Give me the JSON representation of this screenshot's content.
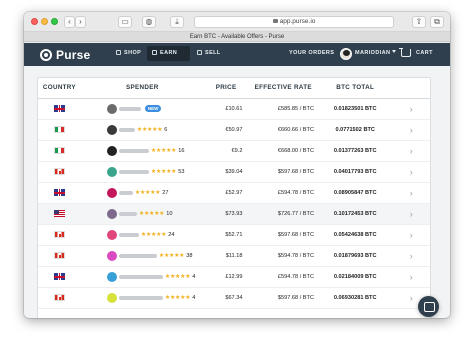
{
  "browser": {
    "url": "app.purse.io",
    "tab_title": "Earn BTC - Available Offers - Purse"
  },
  "nav": {
    "logo_text": "Purse",
    "shop": "SHOP",
    "earn": "EARN",
    "sell": "SELL",
    "your_orders": "YOUR ORDERS",
    "username": "MARIODIAN",
    "cart": "CART"
  },
  "table": {
    "headers": {
      "country": "COUNTRY",
      "spender": "SPENDER",
      "price": "PRICE",
      "effective_rate": "EFFECTIVE RATE",
      "btc_total": "BTC TOTAL"
    },
    "rows": [
      {
        "country": "uk",
        "avatar_color": "#6b6b6b",
        "name_width": 22,
        "stars": "",
        "count": "",
        "badge": "NEW",
        "price": "£10.61",
        "rate": "£585.85 / BTC",
        "btc": "0.01823501 BTC"
      },
      {
        "country": "it",
        "avatar_color": "#3a3a3a",
        "name_width": 16,
        "stars": "★★★★★",
        "count": "6",
        "badge": "",
        "price": "€50.97",
        "rate": "€660.66 / BTC",
        "btc": "0.0771502 BTC"
      },
      {
        "country": "it",
        "avatar_color": "#222222",
        "name_width": 30,
        "stars": "★★★★★",
        "count": "16",
        "badge": "",
        "price": "€9.2",
        "rate": "€668.00 / BTC",
        "btc": "0.01377263 BTC"
      },
      {
        "country": "ca",
        "avatar_color": "#3aa58c",
        "name_width": 30,
        "stars": "★★★★★",
        "count": "53",
        "badge": "",
        "price": "$39.04",
        "rate": "$597.68 / BTC",
        "btc": "0.04017793 BTC"
      },
      {
        "country": "uk",
        "avatar_color": "#c2185b",
        "name_width": 14,
        "stars": "★★★★★",
        "count": "27",
        "badge": "",
        "price": "£52.97",
        "rate": "£594.78 / BTC",
        "btc": "0.08905847 BTC"
      },
      {
        "country": "us",
        "avatar_color": "#7d6a8a",
        "name_width": 18,
        "stars": "★★★★★",
        "count": "10",
        "badge": "",
        "price": "$73.93",
        "rate": "$726.77 / BTC",
        "btc": "0.10172453 BTC"
      },
      {
        "country": "ca",
        "avatar_color": "#e0457b",
        "name_width": 20,
        "stars": "★★★★★",
        "count": "24",
        "badge": "",
        "price": "$52.71",
        "rate": "$597.68 / BTC",
        "btc": "0.05424638 BTC"
      },
      {
        "country": "ca",
        "avatar_color": "#d94bc0",
        "name_width": 38,
        "stars": "★★★★★",
        "count": "38",
        "badge": "",
        "price": "$11.18",
        "rate": "$594.78 / BTC",
        "btc": "0.01879693 BTC"
      },
      {
        "country": "uk",
        "avatar_color": "#37a0d6",
        "name_width": 44,
        "stars": "★★★★★",
        "count": "4",
        "badge": "",
        "price": "£12.99",
        "rate": "£594.78 / BTC",
        "btc": "0.02184009 BTC"
      },
      {
        "country": "ca",
        "avatar_color": "#d6e23a",
        "name_width": 44,
        "stars": "★★★★★",
        "count": "4",
        "badge": "",
        "price": "$67.34",
        "rate": "$597.68 / BTC",
        "btc": "0.06930281 BTC"
      }
    ]
  }
}
